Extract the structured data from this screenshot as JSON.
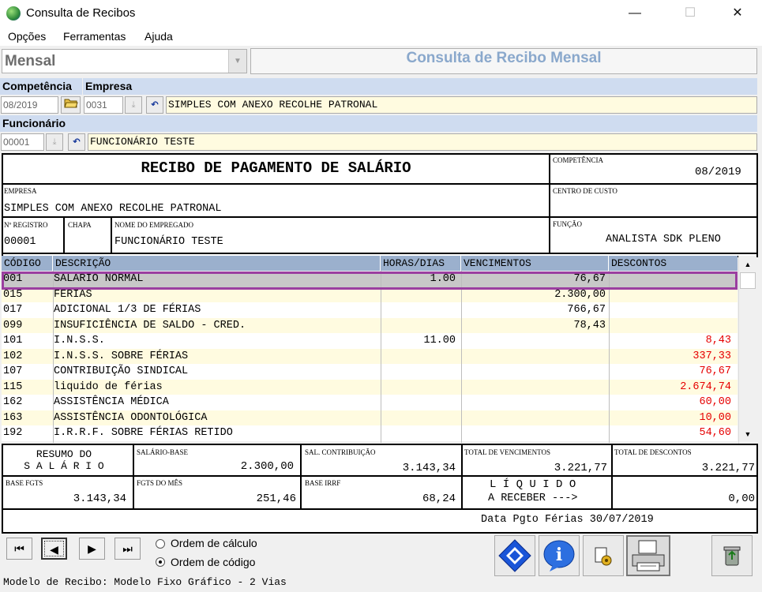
{
  "window": {
    "title": "Consulta de Recibos",
    "minimize": "—",
    "maximize": "☐",
    "close": "✕"
  },
  "menu": [
    "Opções",
    "Ferramentas",
    "Ajuda"
  ],
  "mode": {
    "value": "Mensal",
    "title": "Consulta de Recibo Mensal"
  },
  "labels": {
    "competencia": "Competência",
    "empresa": "Empresa",
    "funcionario": "Funcionário"
  },
  "fields": {
    "competencia": "08/2019",
    "empresa_code": "0031",
    "empresa_name": "SIMPLES COM ANEXO RECOLHE PATRONAL",
    "func_code": "00001",
    "func_name": "FUNCIONÁRIO TESTE"
  },
  "receipt": {
    "title": "RECIBO DE PAGAMENTO DE SALÁRIO",
    "competencia_label": "COMPETÊNCIA",
    "competencia": "08/2019",
    "empresa_label": "EMPRESA",
    "empresa": "SIMPLES COM ANEXO RECOLHE PATRONAL",
    "centro_label": "CENTRO DE CUSTO",
    "centro": "",
    "registro_label": "Nº REGISTRO",
    "registro": "00001",
    "chapa_label": "CHAPA",
    "chapa": "",
    "nome_label": "NOME DO EMPREGADO",
    "nome": "FUNCIONÁRIO TESTE",
    "funcao_label": "FUNÇÃO",
    "funcao": "ANALISTA SDK PLENO"
  },
  "grid": {
    "headers": [
      "CÓDIGO",
      "DESCRIÇÃO",
      "HORAS/DIAS",
      "VENCIMENTOS",
      "DESCONTOS"
    ],
    "rows": [
      {
        "codigo": "001",
        "descricao": "SALÁRIO NORMAL",
        "horas": "1.00",
        "venc": "76,67",
        "desc": ""
      },
      {
        "codigo": "015",
        "descricao": "FÉRIAS",
        "horas": "",
        "venc": "2.300,00",
        "desc": ""
      },
      {
        "codigo": "017",
        "descricao": "ADICIONAL 1/3 DE FÉRIAS",
        "horas": "",
        "venc": "766,67",
        "desc": ""
      },
      {
        "codigo": "099",
        "descricao": "INSUFICIÊNCIA DE SALDO - CRED.",
        "horas": "",
        "venc": "78,43",
        "desc": ""
      },
      {
        "codigo": "101",
        "descricao": "I.N.S.S.",
        "horas": "11.00",
        "venc": "",
        "desc": "8,43"
      },
      {
        "codigo": "102",
        "descricao": "I.N.S.S. SOBRE FÉRIAS",
        "horas": "",
        "venc": "",
        "desc": "337,33"
      },
      {
        "codigo": "107",
        "descricao": "CONTRIBUIÇÃO SINDICAL",
        "horas": "",
        "venc": "",
        "desc": "76,67"
      },
      {
        "codigo": "115",
        "descricao": "liquido de férias",
        "horas": "",
        "venc": "",
        "desc": "2.674,74"
      },
      {
        "codigo": "162",
        "descricao": "ASSISTÊNCIA MÉDICA",
        "horas": "",
        "venc": "",
        "desc": "60,00"
      },
      {
        "codigo": "163",
        "descricao": "ASSISTÊNCIA ODONTOLÓGICA",
        "horas": "",
        "venc": "",
        "desc": "10,00"
      },
      {
        "codigo": "192",
        "descricao": "I.R.R.F. SOBRE FÉRIAS RETIDO",
        "horas": "",
        "venc": "",
        "desc": "54,60"
      }
    ]
  },
  "resumo": {
    "resumo_line1": "RESUMO  DO",
    "resumo_line2": "S A L Á R I O",
    "salario_base_label": "SALÁRIO-BASE",
    "salario_base": "2.300,00",
    "sal_contrib_label": "SAL. CONTRIBUIÇÃO",
    "sal_contrib": "3.143,34",
    "total_venc_label": "TOTAL DE VENCIMENTOS",
    "total_venc": "3.221,77",
    "total_desc_label": "TOTAL DE DESCONTOS",
    "total_desc": "3.221,77",
    "base_fgts_label": "BASE FGTS",
    "base_fgts": "3.143,34",
    "fgts_mes_label": "FGTS DO MÊS",
    "fgts_mes": "251,46",
    "base_irrf_label": "BASE IRRF",
    "base_irrf": "68,24",
    "liquido_line1": "L Í Q U I D O",
    "liquido_line2": "A RECEBER --->",
    "liquido": "0,00",
    "data_pgto": "Data Pgto Férias 30/07/2019"
  },
  "options": {
    "ordem_calculo": "Ordem de cálculo",
    "ordem_codigo": "Ordem de código",
    "selected": "Ordem de código"
  },
  "status": "Modelo de Recibo: Modelo Fixo Gráfico - 2 Vias",
  "colors": {
    "selection_outline": "#9b3fa0",
    "discount_red": "#e60000",
    "header_blue": "#cfdcf0",
    "grid_header": "#9bb0cd",
    "yellow_row": "#fffbe0"
  }
}
